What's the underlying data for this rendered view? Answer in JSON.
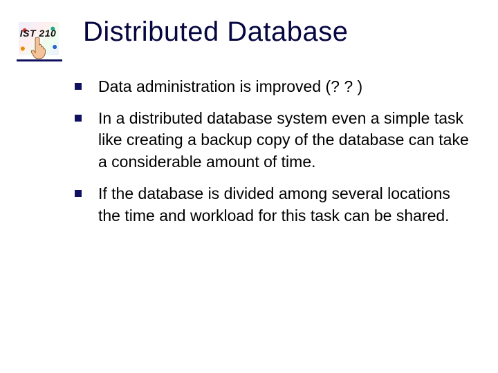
{
  "course_code": "IST 210",
  "slide": {
    "title": "Distributed Database",
    "bullets": [
      "Data administration is improved (? ? )",
      "In a distributed database system even a simple task like creating a backup copy of the database can take a considerable amount of time.",
      "If the database is divided among several locations the time and workload for this task can be shared."
    ]
  },
  "colors": {
    "heading": "#060640",
    "bullet_marker": "#101060",
    "rule": "#101060"
  }
}
